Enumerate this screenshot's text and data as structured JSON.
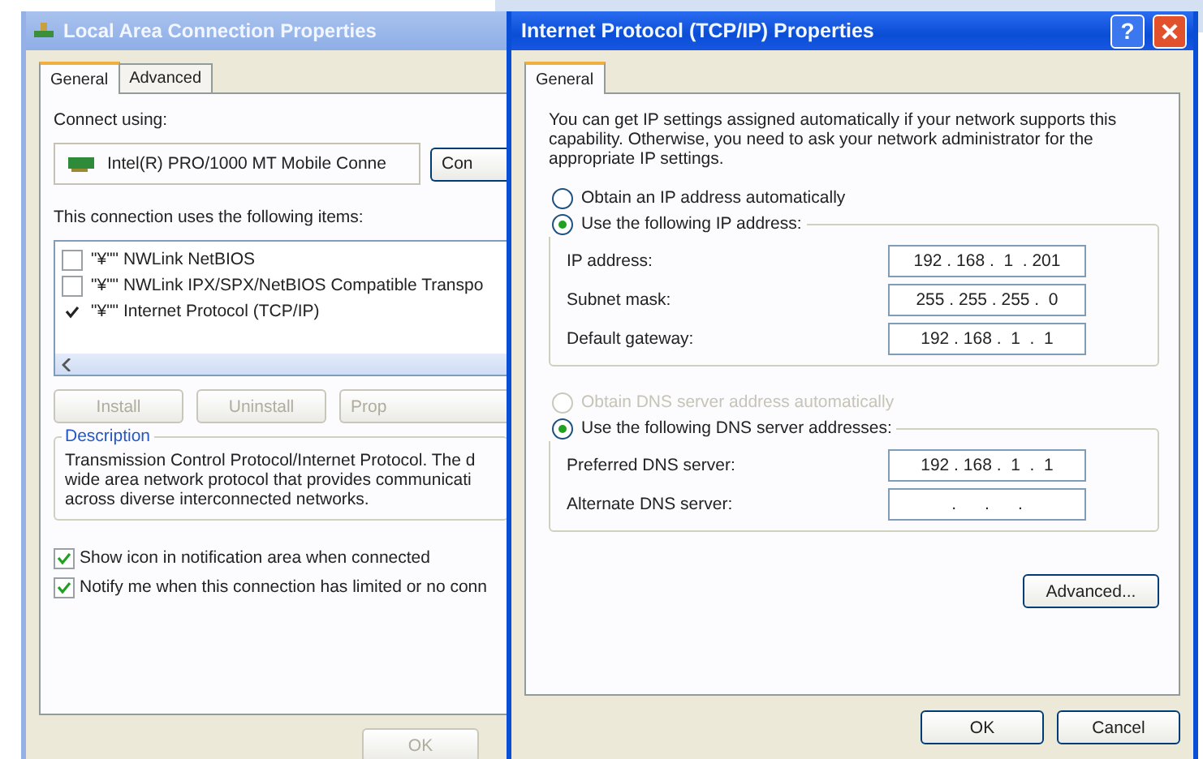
{
  "background_window": {
    "title": "Local Area Connection Properties",
    "tabs": [
      {
        "label": "General",
        "selected": true
      },
      {
        "label": "Advanced",
        "selected": false
      }
    ],
    "connect_using_label": "Connect using:",
    "adapter": "Intel(R) PRO/1000 MT Mobile Conne",
    "configure_button": "Con",
    "items_label": "This connection uses the following items:",
    "items": [
      {
        "label": "\"¥\"\" NWLink NetBIOS",
        "checked": false
      },
      {
        "label": "\"¥\"\" NWLink IPX/SPX/NetBIOS Compatible Transpo",
        "checked": false
      },
      {
        "label": "\"¥\"\" Internet Protocol (TCP/IP)",
        "checked": true
      }
    ],
    "buttons": [
      {
        "label": "Install",
        "disabled": true
      },
      {
        "label": "Uninstall",
        "disabled": true
      },
      {
        "label": "Prop",
        "disabled": true
      }
    ],
    "description_heading": "Description",
    "description_lines": [
      "Transmission Control Protocol/Internet Protocol. The d",
      "wide area network protocol that provides communicati",
      "across diverse interconnected networks."
    ],
    "options": [
      {
        "label": "Show icon in notification area when connected",
        "checked": true
      },
      {
        "label": "Notify me when this connection has limited or no conn",
        "checked": true
      }
    ],
    "ok_button": {
      "label": "OK",
      "disabled": true
    }
  },
  "dialog": {
    "title": "Internet Protocol (TCP/IP) Properties",
    "help_button": "?",
    "tabs": [
      {
        "label": "General",
        "selected": true
      }
    ],
    "intro": "You can get IP settings assigned automatically if your network supports this capability. Otherwise, you need to ask your network administrator for the appropriate IP settings.",
    "ip_options": [
      {
        "label": "Obtain an IP address automatically",
        "selected": false,
        "disabled": false
      },
      {
        "label": "Use the following IP address:",
        "selected": true,
        "disabled": false
      }
    ],
    "ip_fields": [
      {
        "label": "IP address:",
        "value": "192 . 168 .  1  . 201"
      },
      {
        "label": "Subnet mask:",
        "value": "255 . 255 . 255 .  0"
      },
      {
        "label": "Default gateway:",
        "value": "192 . 168 .  1  .  1"
      }
    ],
    "dns_options": [
      {
        "label": "Obtain DNS server address automatically",
        "selected": false,
        "disabled": true
      },
      {
        "label": "Use the following DNS server addresses:",
        "selected": true,
        "disabled": false
      }
    ],
    "dns_fields": [
      {
        "label": "Preferred DNS server:",
        "value": "192 . 168 .  1  .  1"
      },
      {
        "label": "Alternate DNS server:",
        "value": ".      .      ."
      }
    ],
    "advanced_button": "Advanced...",
    "buttons": [
      "OK",
      "Cancel"
    ]
  }
}
